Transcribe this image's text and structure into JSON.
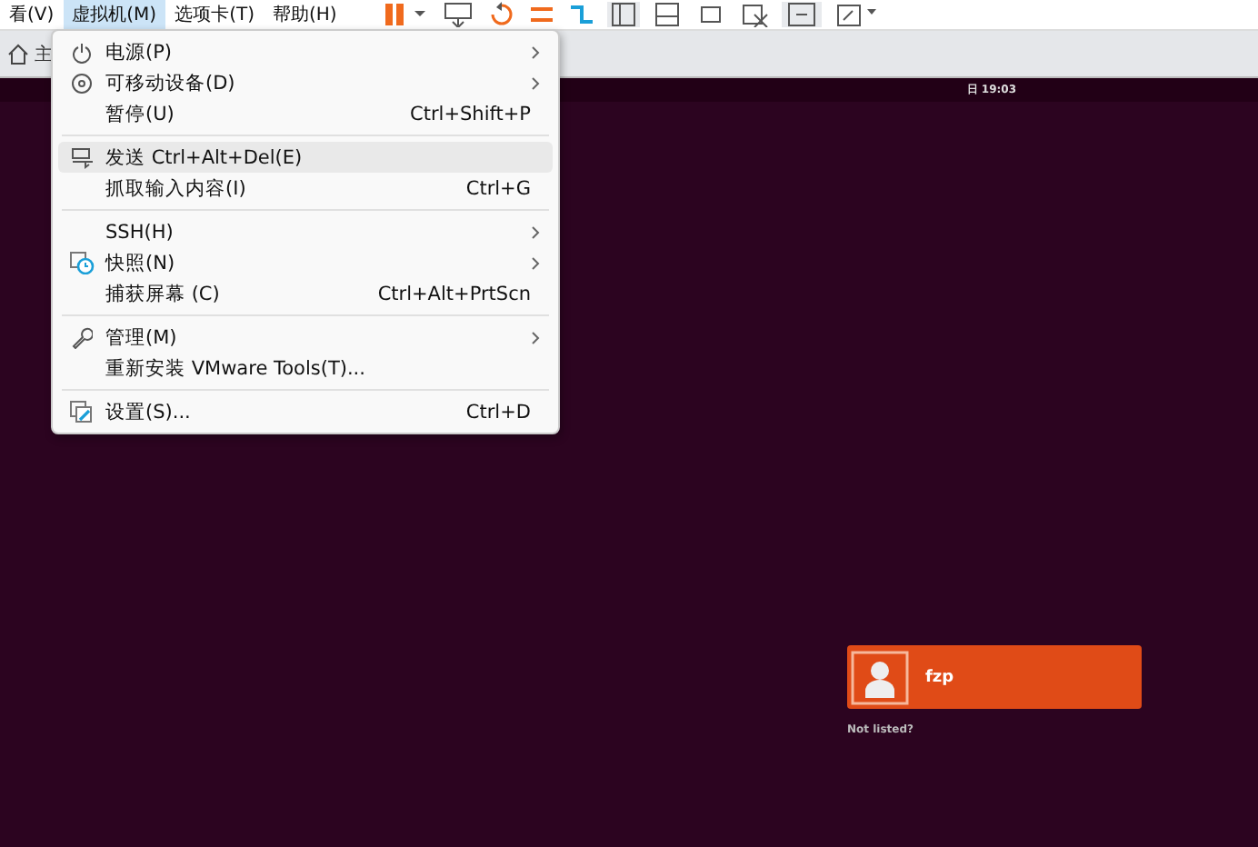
{
  "menu_bar": [
    {
      "label": "看(V)",
      "selected": false
    },
    {
      "label": "虚拟机(M)",
      "selected": true
    },
    {
      "label": "选项卡(T)",
      "selected": false
    },
    {
      "label": "帮助(H)",
      "selected": false
    }
  ],
  "tabs": [
    {
      "label": "主"
    }
  ],
  "vm_menu": [
    {
      "kind": "item",
      "label": "电源(P)",
      "submenu": true,
      "selected": false
    },
    {
      "kind": "item",
      "label": "可移动设备(D)",
      "submenu": true,
      "selected": false
    },
    {
      "kind": "item",
      "label": "暂停(U)",
      "shortcut": "Ctrl+Shift+P",
      "submenu": false,
      "selected": false
    },
    {
      "kind": "separator"
    },
    {
      "kind": "item",
      "label": "发送 Ctrl+Alt+Del(E)",
      "submenu": false,
      "selected": true
    },
    {
      "kind": "item",
      "label": "抓取输入内容(I)",
      "shortcut": "Ctrl+G",
      "submenu": false,
      "selected": false
    },
    {
      "kind": "separator"
    },
    {
      "kind": "item",
      "label": "SSH(H)",
      "submenu": true,
      "selected": false
    },
    {
      "kind": "item",
      "label": "快照(N)",
      "submenu": true,
      "selected": false
    },
    {
      "kind": "item",
      "label": "捕获屏幕 (C)",
      "shortcut": "Ctrl+Alt+PrtScn",
      "submenu": false,
      "selected": false
    },
    {
      "kind": "separator"
    },
    {
      "kind": "item",
      "label": "管理(M)",
      "submenu": true,
      "selected": false
    },
    {
      "kind": "item",
      "label": "重新安装 VMware Tools(T)...",
      "submenu": false,
      "selected": false
    },
    {
      "kind": "separator"
    },
    {
      "kind": "item",
      "label": "设置(S)...",
      "shortcut": "Ctrl+D",
      "submenu": false,
      "selected": false
    }
  ],
  "guest": {
    "clock": "日 19:03",
    "users": [
      {
        "name": "fzp",
        "selected": true
      }
    ],
    "not_listed": "Not listed?"
  }
}
